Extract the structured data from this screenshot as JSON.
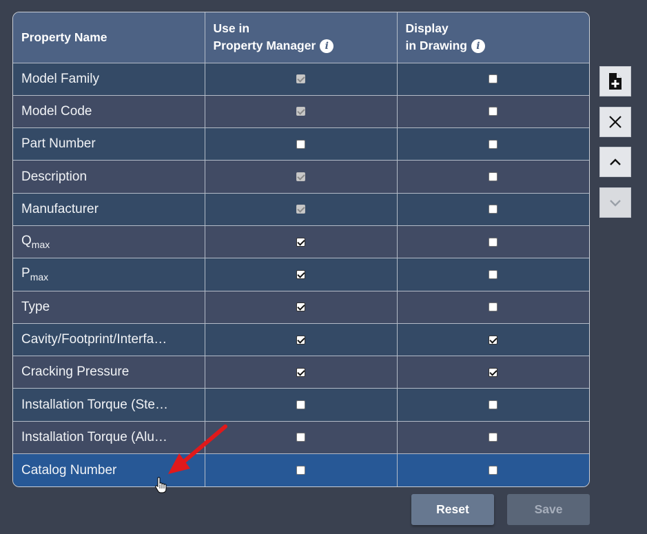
{
  "table": {
    "headers": [
      {
        "line1": "Property Name",
        "line2": ""
      },
      {
        "line1": "Use in",
        "line2": "Property Manager",
        "info_icon": "info-icon"
      },
      {
        "line1": "Display",
        "line2": "in Drawing",
        "info_icon": "info-icon"
      }
    ],
    "rows": [
      {
        "name": "Model Family",
        "sub": "",
        "use_in_pm": "checked-disabled",
        "display_in_drawing": "unchecked"
      },
      {
        "name": "Model Code",
        "sub": "",
        "use_in_pm": "checked-disabled",
        "display_in_drawing": "unchecked"
      },
      {
        "name": "Part Number",
        "sub": "",
        "use_in_pm": "unchecked",
        "display_in_drawing": "unchecked"
      },
      {
        "name": "Description",
        "sub": "",
        "use_in_pm": "checked-disabled",
        "display_in_drawing": "unchecked"
      },
      {
        "name": "Manufacturer",
        "sub": "",
        "use_in_pm": "checked-disabled",
        "display_in_drawing": "unchecked"
      },
      {
        "name": "Q",
        "sub": "max",
        "use_in_pm": "checked",
        "display_in_drawing": "unchecked"
      },
      {
        "name": "P",
        "sub": "max",
        "use_in_pm": "checked",
        "display_in_drawing": "unchecked"
      },
      {
        "name": "Type",
        "sub": "",
        "use_in_pm": "checked",
        "display_in_drawing": "unchecked"
      },
      {
        "name": "Cavity/Footprint/Interfa…",
        "sub": "",
        "use_in_pm": "checked",
        "display_in_drawing": "checked"
      },
      {
        "name": "Cracking Pressure",
        "sub": "",
        "use_in_pm": "checked",
        "display_in_drawing": "checked"
      },
      {
        "name": "Installation Torque (Ste…",
        "sub": "",
        "use_in_pm": "unchecked",
        "display_in_drawing": "unchecked"
      },
      {
        "name": "Installation Torque (Alu…",
        "sub": "",
        "use_in_pm": "unchecked",
        "display_in_drawing": "unchecked"
      },
      {
        "name": "Catalog Number",
        "sub": "",
        "use_in_pm": "unchecked",
        "display_in_drawing": "unchecked",
        "selected": true
      }
    ]
  },
  "side_buttons": [
    {
      "name": "add-property-button",
      "icon": "file-plus-icon"
    },
    {
      "name": "delete-property-button",
      "icon": "close-icon"
    },
    {
      "name": "move-up-button",
      "icon": "chevron-up-icon"
    },
    {
      "name": "move-down-button",
      "icon": "chevron-down-icon",
      "disabled": true
    }
  ],
  "buttons": {
    "reset_label": "Reset",
    "save_label": "Save"
  },
  "colors": {
    "background": "#3a4150",
    "header": "#4d6284",
    "row_dark": "#344a66",
    "row_light": "#414b64",
    "row_selected": "#275896",
    "annotation_arrow": "#e0191b"
  },
  "annotation": {
    "arrow": "red-arrow-icon",
    "cursor": "hand-cursor-icon"
  }
}
